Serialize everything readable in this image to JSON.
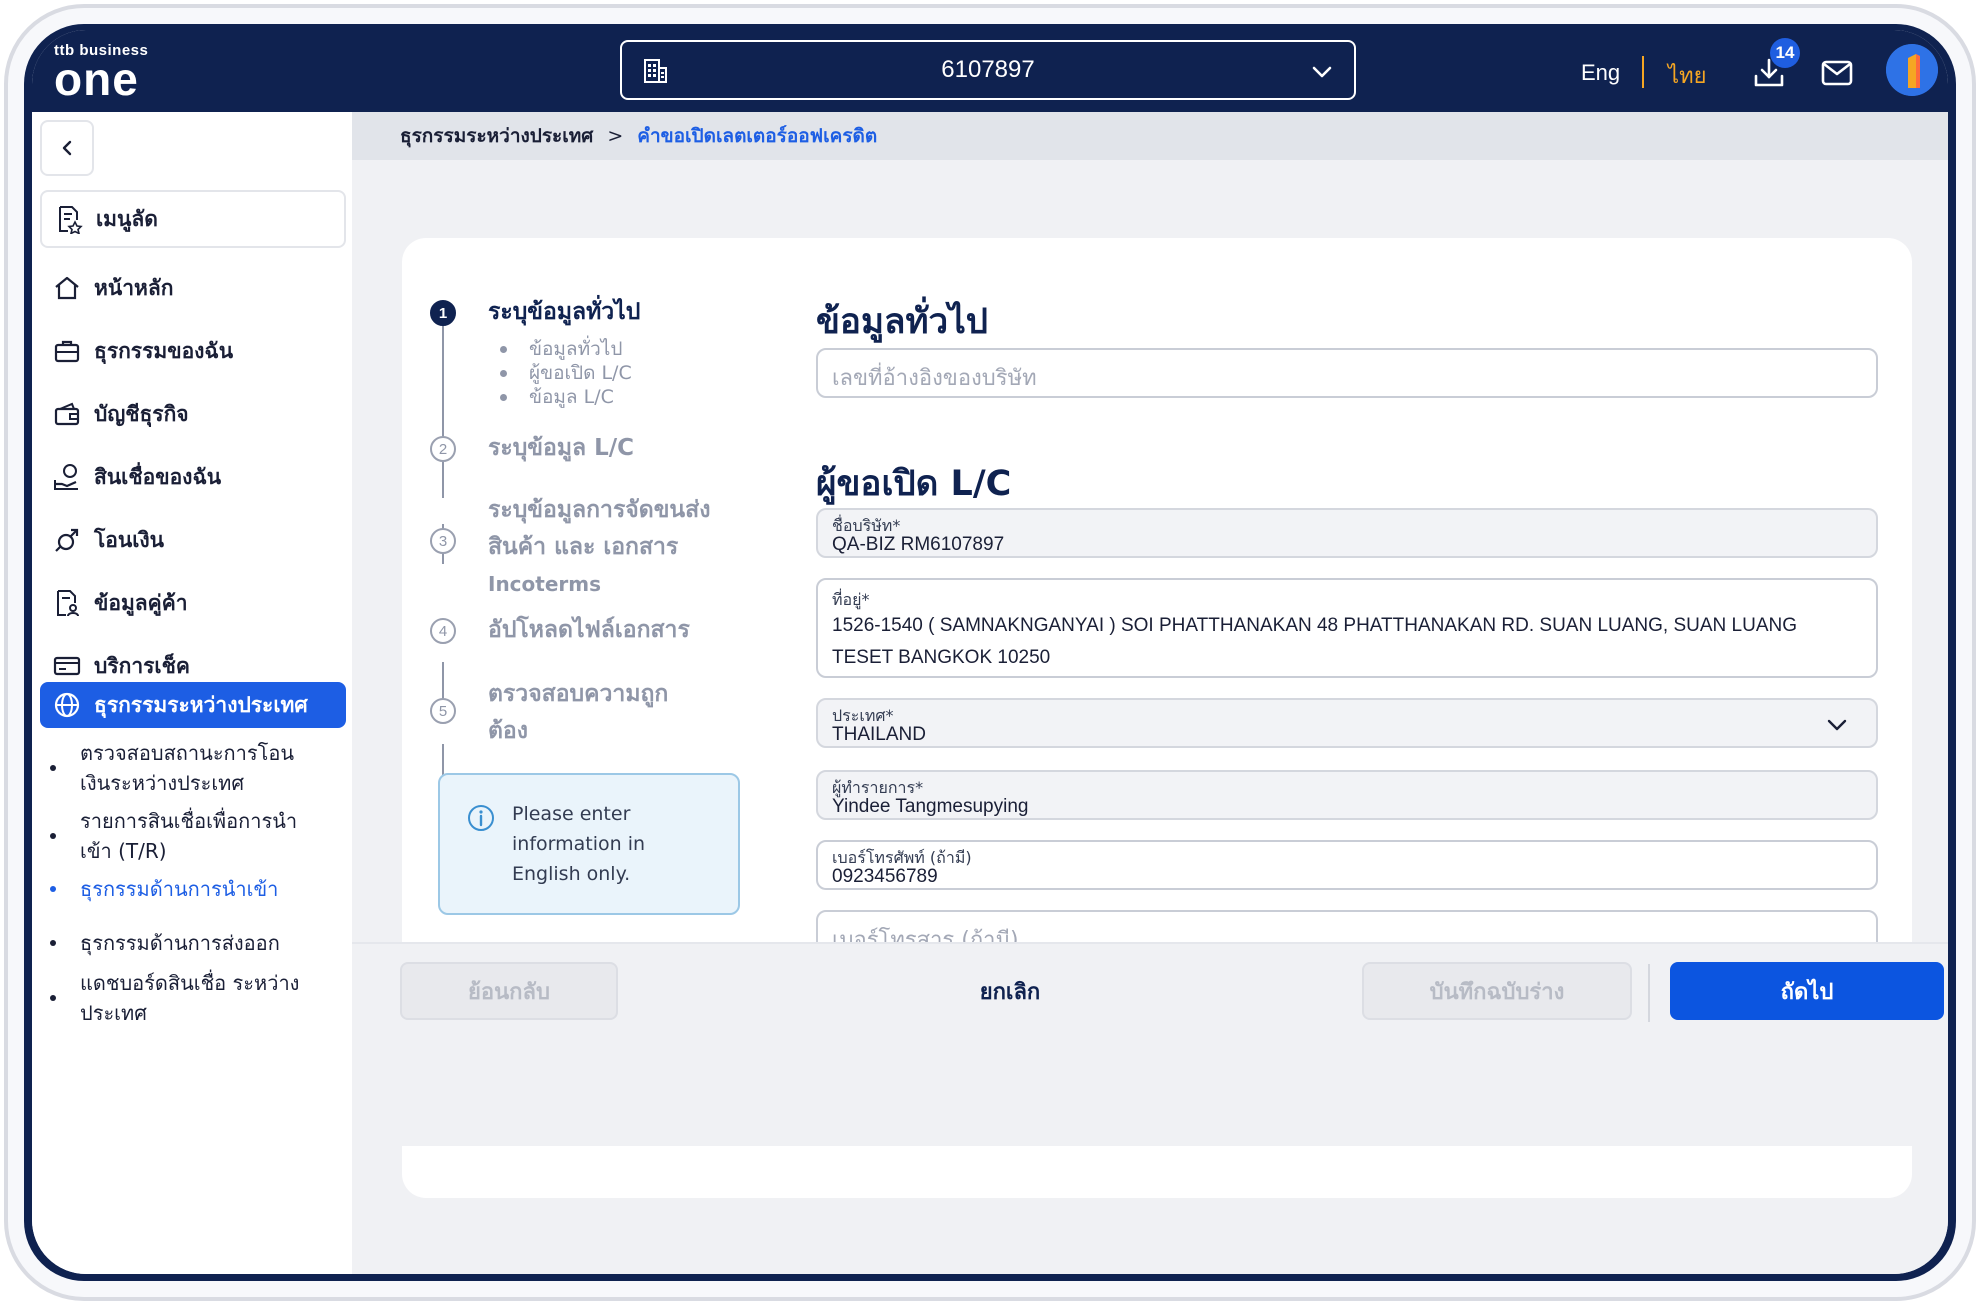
{
  "header": {
    "logo_small": "ttb business",
    "logo_main": "one",
    "account_number": "6107897",
    "lang_en": "Eng",
    "lang_th": "ไทย",
    "download_count": "14",
    "icons": [
      "building-icon",
      "chevron-down-icon",
      "download-icon",
      "mail-icon",
      "avatar"
    ]
  },
  "sidebar": {
    "shortcut_label": "เมนูลัด",
    "items": [
      {
        "label": "หน้าหลัก",
        "icon": "home-icon"
      },
      {
        "label": "ธุรกรรมของฉัน",
        "icon": "briefcase-icon"
      },
      {
        "label": "บัญชีธุรกิจ",
        "icon": "wallet-icon"
      },
      {
        "label": "สินเชื่อของฉัน",
        "icon": "loan-icon"
      },
      {
        "label": "โอนเงิน",
        "icon": "transfer-icon"
      },
      {
        "label": "ข้อมูลคู่ค้า",
        "icon": "partner-icon"
      },
      {
        "label": "บริการเช็ค",
        "icon": "cheque-icon"
      },
      {
        "label": "ธุรกรรมระหว่างประเทศ",
        "icon": "globe-icon",
        "active": true
      }
    ],
    "sub_items": [
      {
        "label_lines": [
          "ตรวจสอบสถานะการโอน",
          "เงินระหว่างประเทศ"
        ]
      },
      {
        "label_lines": [
          "รายการสินเชื่อเพื่อการนำ",
          "เข้า (T/R)"
        ]
      },
      {
        "label_lines": [
          "ธุรกรรมด้านการนำเข้า"
        ],
        "current": true
      },
      {
        "label_lines": [
          "ธุรกรรมด้านการส่งออก"
        ]
      },
      {
        "label_lines": [
          "แดชบอร์ดสินเชื่อ ระหว่าง",
          "ประเทศ"
        ]
      }
    ]
  },
  "breadcrumb": {
    "parent": "ธุรกรรมระหว่างประเทศ",
    "separator": ">",
    "current": "คำขอเปิดเลตเตอร์ออฟเครดิต"
  },
  "stepper": {
    "steps": [
      {
        "num": "1",
        "title_lines": [
          "ระบุข้อมูลทั่วไป"
        ],
        "active": true
      },
      {
        "num": "2",
        "title_lines": [
          "ระบุข้อมูล L/C"
        ]
      },
      {
        "num": "3",
        "title_lines": [
          "ระบุข้อมูลการจัดขนส่ง",
          "สินค้า และ เอกสาร",
          "Incoterms"
        ]
      },
      {
        "num": "4",
        "title_lines": [
          "อัปโหลดไฟล์เอกสาร"
        ]
      },
      {
        "num": "5",
        "title_lines": [
          "ตรวจสอบความถูก",
          "ต้อง"
        ]
      }
    ],
    "step1_subs": [
      "ข้อมูลทั่วไป",
      "ผู้ขอเปิด L/C",
      "ข้อมูล L/C"
    ],
    "info_text": "Please enter information in English only."
  },
  "form": {
    "section1_title": "ข้อมูลทั่วไป",
    "company_ref_placeholder": "เลขที่อ้างอิงของบริษัท",
    "section2_title": "ผู้ขอเปิด L/C",
    "company_name_label": "ชื่อบริษัท*",
    "company_name_value": "QA-BIZ RM6107897",
    "address_label": "ที่อยู่*",
    "address_value": "1526-1540 ( SAMNAKNGANYAI ) SOI PHATTHANAKAN 48 PHATTHANAKAN RD. SUAN LUANG, SUAN LUANG TESET BANGKOK 10250",
    "country_label": "ประเทศ*",
    "country_value": "THAILAND",
    "maker_label": "ผู้ทำรายการ*",
    "maker_value": "Yindee Tangmesupying",
    "phone_label": "เบอร์โทรศัพท์ (ถ้ามี)",
    "phone_value": "0923456789",
    "fax_placeholder": "เบอร์โทรสาร (ถ้ามี)"
  },
  "footer": {
    "back_label": "ย้อนกลับ",
    "cancel_label": "ยกเลิก",
    "draft_label": "บันทึกฉบับร่าง",
    "next_label": "ถัดไป"
  },
  "colors": {
    "navy": "#0f2250",
    "primary_blue": "#0c55e0",
    "accent_orange": "#f5a623",
    "info_bg": "#eaf4fb"
  }
}
